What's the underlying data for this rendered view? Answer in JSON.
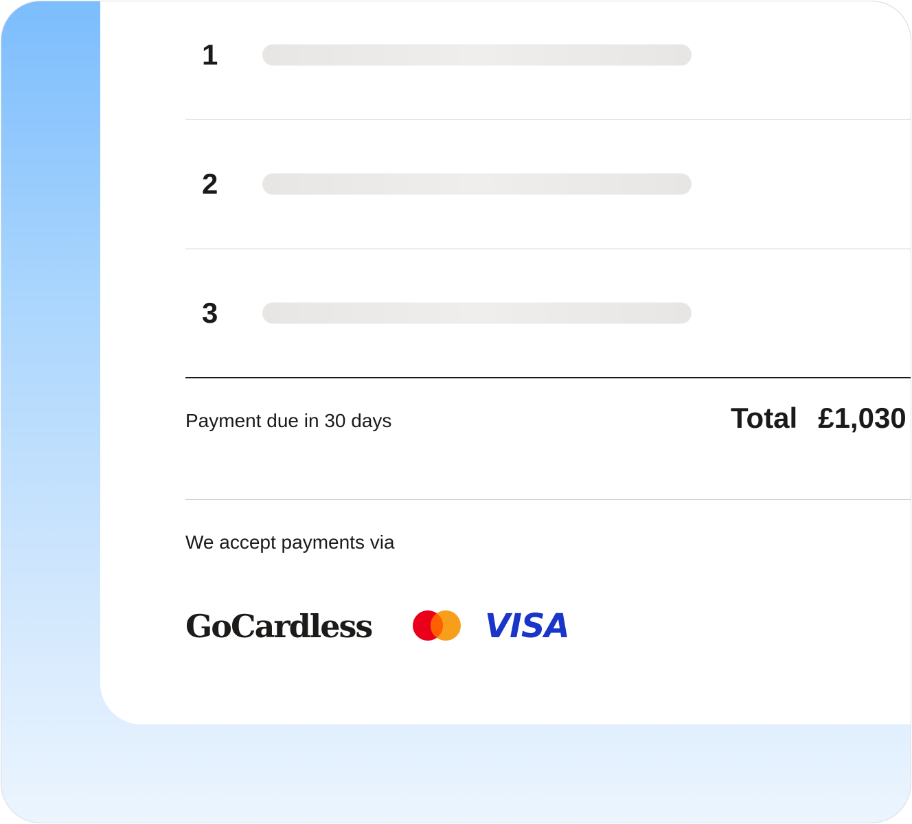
{
  "invoice": {
    "rows": [
      {
        "number": "1"
      },
      {
        "number": "2"
      },
      {
        "number": "3"
      }
    ],
    "payment_due_text": "Payment due in 30 days",
    "total_label": "Total",
    "total_amount": "£1,030"
  },
  "payments": {
    "accept_text": "We accept payments via",
    "providers": {
      "gocardless": "GoCardless",
      "mastercard_icon": "mastercard-icon",
      "visa": "VISA"
    }
  },
  "colors": {
    "background_gradient_top": "#7cbdfd",
    "background_gradient_bottom": "#ecf5fe",
    "mastercard_red": "#eb001b",
    "mastercard_orange": "#f79e1b",
    "visa_blue": "#1a36c9"
  }
}
